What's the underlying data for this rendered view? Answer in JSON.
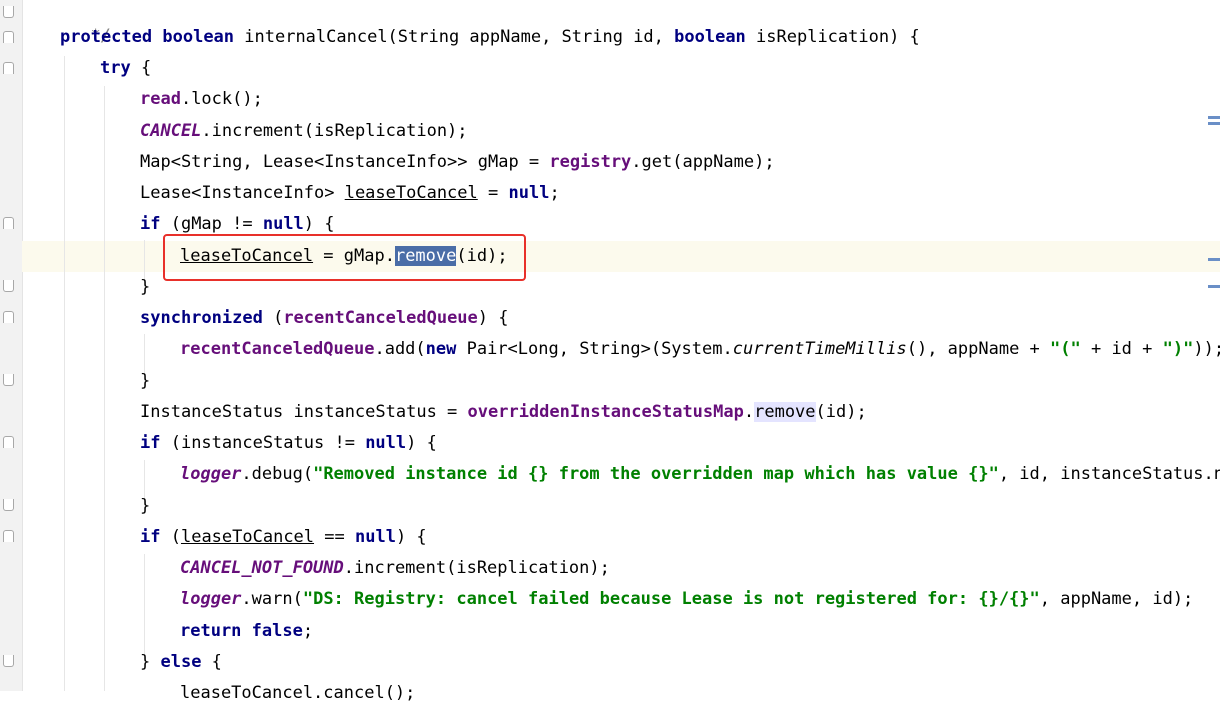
{
  "editor": {
    "line0": {
      "cmt": "*/"
    },
    "line1": {
      "kw1": "protected",
      "kw2": "boolean",
      "t1": " internalCancel(String appName, String id, ",
      "kw3": "boolean",
      "t2": " isReplication) {"
    },
    "line2": {
      "kw": "try",
      "t": " {"
    },
    "line3": {
      "fld": "read",
      "t": ".lock();"
    },
    "line4": {
      "sfld": "CANCEL",
      "t": ".increment(isReplication);"
    },
    "line5": {
      "t1": "Map<String, Lease<InstanceInfo>> gMap = ",
      "fld": "registry",
      "t2": ".get(appName);"
    },
    "line6": {
      "t1": "Lease<InstanceInfo> ",
      "var": "leaseToCancel",
      "t2": " = ",
      "kw": "null",
      "t3": ";"
    },
    "line7": {
      "kw1": "if",
      "t1": " (gMap != ",
      "kw2": "null",
      "t2": ") {"
    },
    "line8": {
      "var": "leaseToCancel",
      "t1": " = gMap.",
      "sel": "remove",
      "t2": "(id);"
    },
    "line9": {
      "t": "}"
    },
    "line10": {
      "kw": "synchronized",
      "t1": " (",
      "fld": "recentCanceledQueue",
      "t2": ") {"
    },
    "line11": {
      "fld": "recentCanceledQueue",
      "t1": ".add(",
      "kw": "new",
      "t2": " Pair<Long, String>(System.",
      "smeth": "currentTimeMillis",
      "t3": "(), appName + ",
      "s1": "\"(\"",
      "t4": " + id + ",
      "s2": "\")\"",
      "t5": "));"
    },
    "line12": {
      "t": "}"
    },
    "line13": {
      "t1": "InstanceStatus instanceStatus = ",
      "fld": "overriddenInstanceStatusMap",
      "t2": ".",
      "usage": "remove",
      "t3": "(id);"
    },
    "line14": {
      "kw1": "if",
      "t1": " (instanceStatus != ",
      "kw2": "null",
      "t2": ") {"
    },
    "line15": {
      "sfld": "logger",
      "t1": ".debug(",
      "str": "\"Removed instance id {} from the overridden map which has value {}\"",
      "t2": ", id, instanceStatus.nam"
    },
    "line16": {
      "t": "}"
    },
    "line17": {
      "kw1": "if",
      "t1": " (",
      "var": "leaseToCancel",
      "t2": " == ",
      "kw2": "null",
      "t3": ") {"
    },
    "line18": {
      "sfld": "CANCEL_NOT_FOUND",
      "t": ".increment(isReplication);"
    },
    "line19": {
      "sfld": "logger",
      "t1": ".warn(",
      "str": "\"DS: Registry: cancel failed because Lease is not registered for: {}/{}\"",
      "t2": ", appName, id);"
    },
    "line20": {
      "kw1": "return",
      "kw2": "false",
      "t": ";"
    },
    "line21": {
      "t1": "} ",
      "kw": "else",
      "t2": " {"
    },
    "line22": {
      "t": "leaseToCancel.cancel();"
    }
  },
  "colors": {
    "keyword": "#000080",
    "field": "#660e7a",
    "string": "#008000",
    "selection": "#4a6da7",
    "highlight_box": "#e8302a",
    "caret_row": "#fcfaed"
  }
}
